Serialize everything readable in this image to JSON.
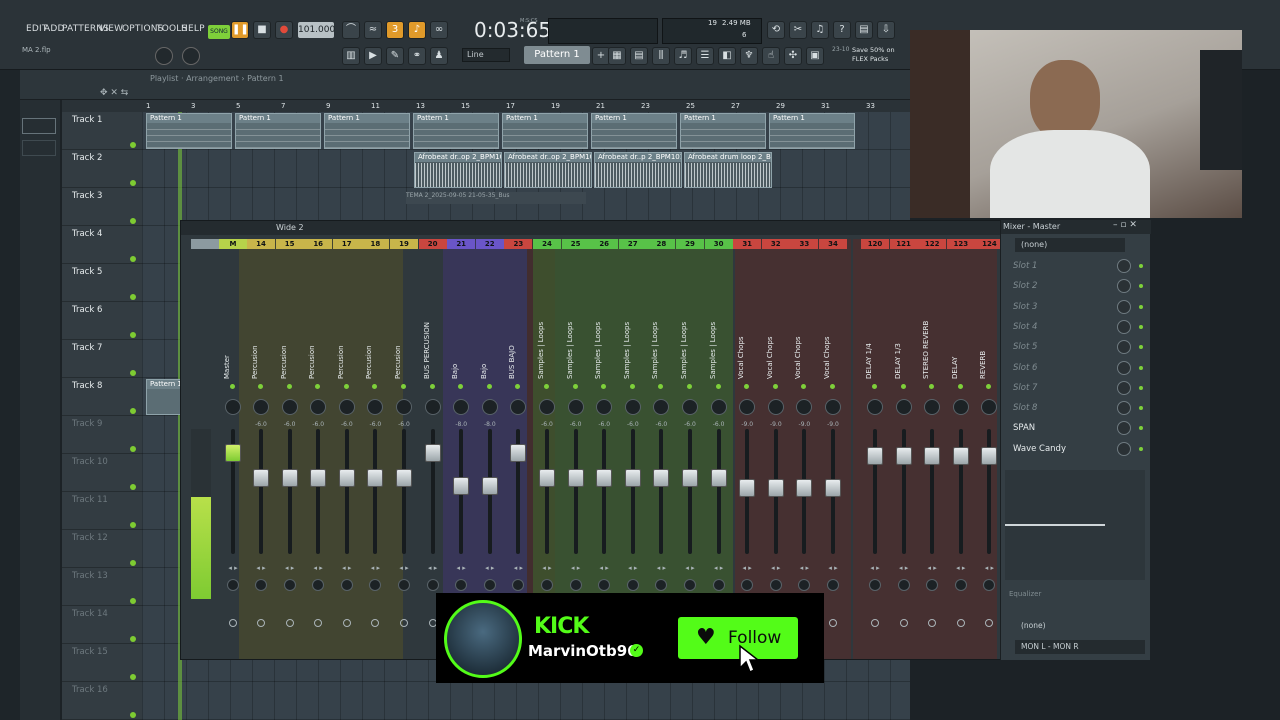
{
  "menu": [
    "EDIT",
    "ADD",
    "PATTERNS",
    "VIEW",
    "OPTIONS",
    "TOOLS",
    "HELP"
  ],
  "transport": {
    "mode": "SONG",
    "tempo": "101.000",
    "time": "0:03:65",
    "time_small": "M:S:CS"
  },
  "toolbar": {
    "snap": "Line",
    "pattern": "Pattern 1",
    "cpu": "19",
    "mem": "2.49 MB",
    "voices": "6",
    "hint": "Save 50% on FLEX Packs",
    "hint_code": "23-10"
  },
  "file": {
    "name": "MA 2.flp"
  },
  "playlist": {
    "breadcrumb": "Playlist · Arrangement › Pattern 1"
  },
  "ruler": [
    "1",
    "3",
    "5",
    "7",
    "9",
    "11",
    "13",
    "15",
    "17",
    "19",
    "21",
    "23",
    "25",
    "27",
    "29",
    "31",
    "33"
  ],
  "tracks": [
    "Track 1",
    "Track 2",
    "Track 3",
    "Track 4",
    "Track 5",
    "Track 6",
    "Track 7",
    "Track 8",
    "Track 9",
    "Track 10",
    "Track 11",
    "Track 12",
    "Track 13",
    "Track 14",
    "Track 15",
    "Track 16"
  ],
  "clips": {
    "pattern": "Pattern 1",
    "audio": [
      "Afrobeat dr..op 2_BPM101",
      "Afrobeat dr..op 2_BPM101",
      "Afrobeat dr..p 2_BPM101",
      "Afrobeat drum loop 2_BPM101"
    ],
    "ghost": "TEMA 2_2025-09-05 21-05-35_Bus"
  },
  "mixer": {
    "title": "Wide 2",
    "panel_title": "Mixer - Master",
    "strips": [
      {
        "num": "",
        "name": "",
        "color": "#8c9aa0",
        "db": ""
      },
      {
        "num": "M",
        "name": "Master",
        "color": "#b7d34a",
        "db": ""
      },
      {
        "num": "14",
        "name": "Percusion",
        "color": "#c8b54a",
        "db": "-6.0"
      },
      {
        "num": "15",
        "name": "Percusion",
        "color": "#c8b54a",
        "db": "-6.0"
      },
      {
        "num": "16",
        "name": "Percusion",
        "color": "#c8b54a",
        "db": "-6.0"
      },
      {
        "num": "17",
        "name": "Percusion",
        "color": "#c8b54a",
        "db": "-6.0"
      },
      {
        "num": "18",
        "name": "Percusion",
        "color": "#c8b54a",
        "db": "-6.0"
      },
      {
        "num": "19",
        "name": "Percusion",
        "color": "#c8b54a",
        "db": "-6.0"
      },
      {
        "num": "20",
        "name": "BUS PERCUSION",
        "color": "#c9463f",
        "db": ""
      },
      {
        "num": "21",
        "name": "Bajo",
        "color": "#6a55c8",
        "db": "-8.0"
      },
      {
        "num": "22",
        "name": "Bajo",
        "color": "#6a55c8",
        "db": "-8.0"
      },
      {
        "num": "23",
        "name": "BUS BAJO",
        "color": "#c9463f",
        "db": ""
      },
      {
        "num": "24",
        "name": "Samples | Loops",
        "color": "#58c248",
        "db": "-6.0"
      },
      {
        "num": "25",
        "name": "Samples | Loops",
        "color": "#58c248",
        "db": "-6.0"
      },
      {
        "num": "26",
        "name": "Samples | Loops",
        "color": "#58c248",
        "db": "-6.0"
      },
      {
        "num": "27",
        "name": "Samples | Loops",
        "color": "#58c248",
        "db": "-6.0"
      },
      {
        "num": "28",
        "name": "Samples | Loops",
        "color": "#58c248",
        "db": "-6.0"
      },
      {
        "num": "29",
        "name": "Samples | Loops",
        "color": "#58c248",
        "db": "-6.0"
      },
      {
        "num": "30",
        "name": "Samples | Loops",
        "color": "#58c248",
        "db": "-6.0"
      },
      {
        "num": "31",
        "name": "Vocal Chops",
        "color": "#c9463f",
        "db": "-9.0"
      },
      {
        "num": "32",
        "name": "Vocal Chops",
        "color": "#c9463f",
        "db": "-9.0"
      },
      {
        "num": "33",
        "name": "Vocal Chops",
        "color": "#c9463f",
        "db": "-9.0"
      },
      {
        "num": "34",
        "name": "Vocal Chops",
        "color": "#c9463f",
        "db": "-9.0"
      },
      {
        "num": "120",
        "name": "DELAY 1/4",
        "color": "#c9463f",
        "db": ""
      },
      {
        "num": "121",
        "name": "DELAY 1/3",
        "color": "#c9463f",
        "db": ""
      },
      {
        "num": "122",
        "name": "STEREO REVERB",
        "color": "#c9463f",
        "db": ""
      },
      {
        "num": "123",
        "name": "DELAY",
        "color": "#c9463f",
        "db": ""
      },
      {
        "num": "124",
        "name": "REVERB",
        "color": "#c9463f",
        "db": ""
      }
    ],
    "input": "(none)",
    "slots": [
      "Slot 1",
      "Slot 2",
      "Slot 3",
      "Slot 4",
      "Slot 5",
      "Slot 6",
      "Slot 7",
      "Slot 8"
    ],
    "plugins": [
      "SPAN",
      "Wave Candy"
    ],
    "eq_label": "Equalizer",
    "output_none": "(none)",
    "output": "MON L - MON R"
  },
  "overlay": {
    "platform": "KICK",
    "user": "MarvinOtb96",
    "follow": "Follow",
    "accent": "#53fc18"
  }
}
